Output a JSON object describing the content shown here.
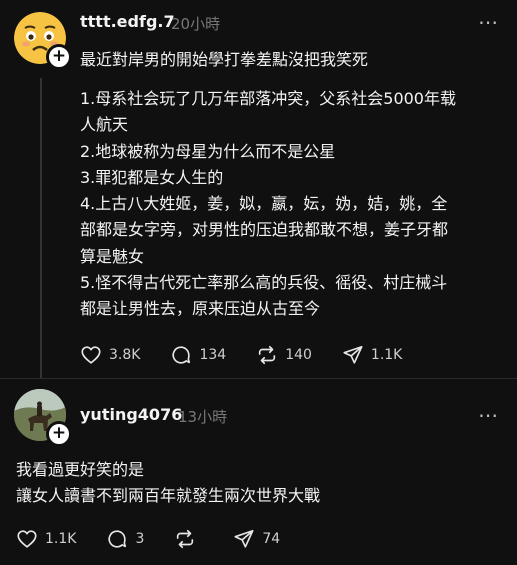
{
  "post1": {
    "username": "tttt.edfg.7",
    "time": "20小時",
    "more_icon": "more-horizontal-icon",
    "title": "最近對岸男的開始學打拳差點沒把我笑死",
    "body": "1.母系社会玩了几万年部落冲突，父系社会5000年载\n人航天\n2.地球被称为母星为什么而不是公星\n3.罪犯都是女人生的\n4.上古八大姓姬，姜，姒，嬴，妘，妫，姞，姚，全\n部都是女字旁，对男性的压迫我都敢不想，姜子牙都\n算是魅女\n5.怪不得古代死亡率那么高的兵役、徭役、村庄械斗\n都是让男性去，原来压迫从古至今",
    "likes": "3.8K",
    "comments": "134",
    "reposts": "140",
    "shares": "1.1K"
  },
  "post2": {
    "username": "yuting4076",
    "time": "13小時",
    "body": "我看過更好笑的是\n讓女人讀書不到兩百年就發生兩次世界大戰",
    "likes": "1.1K",
    "comments": "3",
    "reposts": "",
    "shares": "74"
  },
  "colors": {
    "background": "#101010",
    "text": "#f3f3f3",
    "muted": "#777777",
    "emoji_yellow": "#f6c343"
  }
}
